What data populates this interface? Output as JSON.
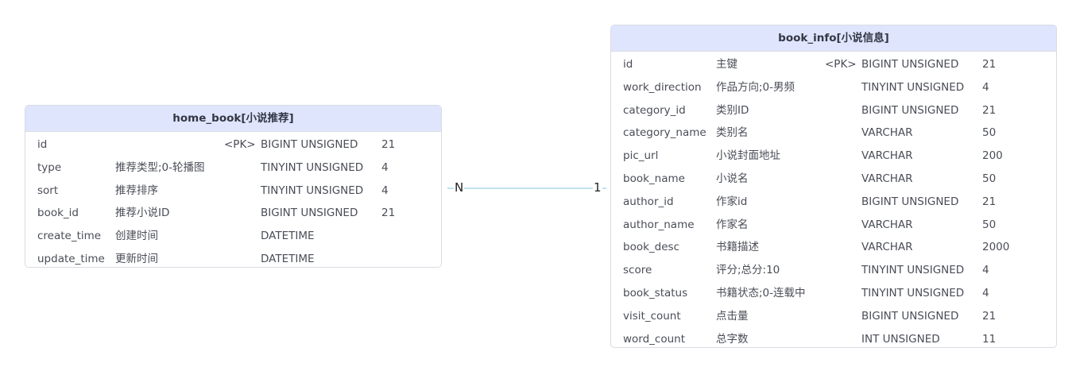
{
  "tables": [
    {
      "title": "home_book[小说推荐]",
      "columns": [
        {
          "name": "id",
          "comment": "",
          "key": "<PK>",
          "type": "BIGINT UNSIGNED",
          "length": "21"
        },
        {
          "name": "type",
          "comment": "推荐类型;0-轮播图",
          "key": "",
          "type": "TINYINT UNSIGNED",
          "length": "4"
        },
        {
          "name": "sort",
          "comment": "推荐排序",
          "key": "",
          "type": "TINYINT UNSIGNED",
          "length": "4"
        },
        {
          "name": "book_id",
          "comment": "推荐小说ID",
          "key": "",
          "type": "BIGINT UNSIGNED",
          "length": "21"
        },
        {
          "name": "create_time",
          "comment": "创建时间",
          "key": "",
          "type": "DATETIME",
          "length": ""
        },
        {
          "name": "update_time",
          "comment": "更新时间",
          "key": "",
          "type": "DATETIME",
          "length": ""
        }
      ]
    },
    {
      "title": "book_info[小说信息]",
      "columns": [
        {
          "name": "id",
          "comment": "主键",
          "key": "<PK>",
          "type": "BIGINT UNSIGNED",
          "length": "21"
        },
        {
          "name": "work_direction",
          "comment": "作品方向;0-男频",
          "key": "",
          "type": "TINYINT UNSIGNED",
          "length": "4"
        },
        {
          "name": "category_id",
          "comment": "类别ID",
          "key": "",
          "type": "BIGINT UNSIGNED",
          "length": "21"
        },
        {
          "name": "category_name",
          "comment": "类别名",
          "key": "",
          "type": "VARCHAR",
          "length": "50"
        },
        {
          "name": "pic_url",
          "comment": "小说封面地址",
          "key": "",
          "type": "VARCHAR",
          "length": "200"
        },
        {
          "name": "book_name",
          "comment": "小说名",
          "key": "",
          "type": "VARCHAR",
          "length": "50"
        },
        {
          "name": "author_id",
          "comment": "作家id",
          "key": "",
          "type": "BIGINT UNSIGNED",
          "length": "21"
        },
        {
          "name": "author_name",
          "comment": "作家名",
          "key": "",
          "type": "VARCHAR",
          "length": "50"
        },
        {
          "name": "book_desc",
          "comment": "书籍描述",
          "key": "",
          "type": "VARCHAR",
          "length": "2000"
        },
        {
          "name": "score",
          "comment": "评分;总分:10",
          "key": "",
          "type": "TINYINT UNSIGNED",
          "length": "4"
        },
        {
          "name": "book_status",
          "comment": "书籍状态;0-连载中",
          "key": "",
          "type": "TINYINT UNSIGNED",
          "length": "4"
        },
        {
          "name": "visit_count",
          "comment": "点击量",
          "key": "",
          "type": "BIGINT UNSIGNED",
          "length": "21"
        },
        {
          "name": "word_count",
          "comment": "总字数",
          "key": "",
          "type": "INT UNSIGNED",
          "length": "11"
        }
      ]
    }
  ],
  "relationship": {
    "from_cardinality": "N",
    "to_cardinality": "1"
  },
  "colors": {
    "header_bg": "#dfe5fd",
    "border": "#d9dce3",
    "relation_line": "#bfe3ef"
  }
}
